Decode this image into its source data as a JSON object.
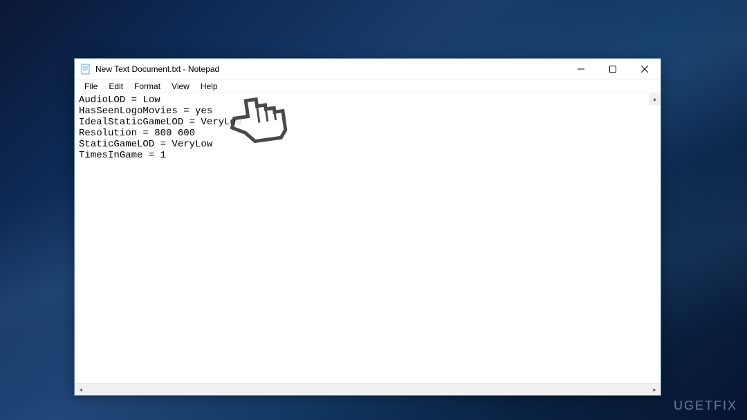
{
  "window": {
    "title": "New Text Document.txt - Notepad"
  },
  "menubar": {
    "items": [
      "File",
      "Edit",
      "Format",
      "View",
      "Help"
    ]
  },
  "editor": {
    "content": "AudioLOD = Low\nHasSeenLogoMovies = yes\nIdealStaticGameLOD = VeryLow\nResolution = 800 600\nStaticGameLOD = VeryLow\nTimesInGame = 1"
  },
  "watermark": "UGETFIX"
}
